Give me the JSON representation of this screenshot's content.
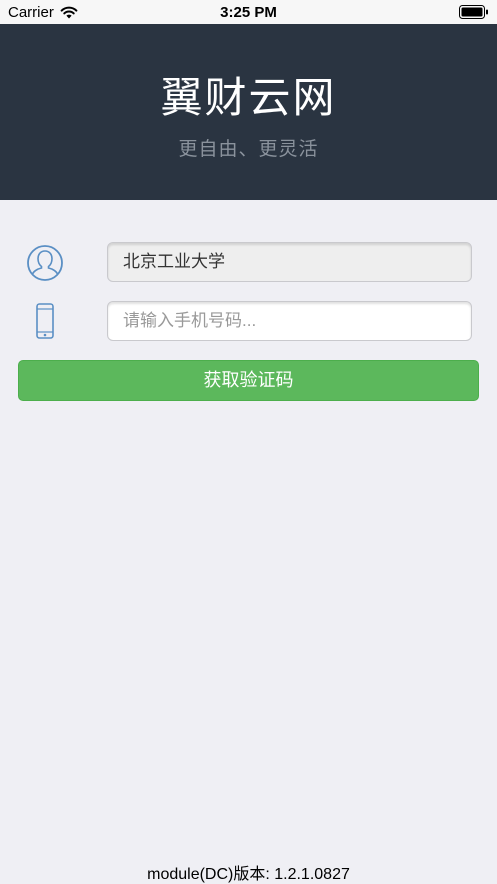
{
  "status_bar": {
    "carrier": "Carrier",
    "time": "3:25 PM",
    "wifi_icon": "wifi-icon",
    "battery_icon": "battery-icon"
  },
  "header": {
    "title": "翼财云网",
    "subtitle": "更自由、更灵活",
    "background_color": "#2a3441"
  },
  "form": {
    "user_icon": "user-icon",
    "school_value": "北京工业大学",
    "phone_icon": "phone-icon",
    "phone_placeholder": "请输入手机号码...",
    "phone_value": "",
    "submit_label": "获取验证码",
    "accent_color": "#5cb85c"
  },
  "footer": {
    "version_text": "module(DC)版本: 1.2.1.0827"
  }
}
